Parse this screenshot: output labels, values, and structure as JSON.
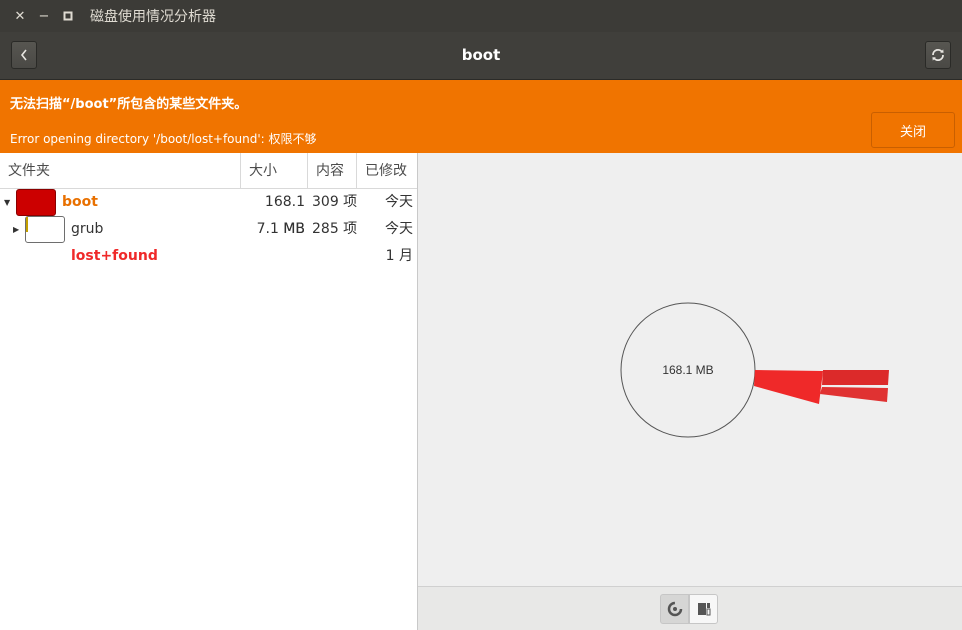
{
  "window": {
    "title": "磁盘使用情况分析器",
    "close_glyph": "✕",
    "minimize_glyph": "−",
    "maximize_glyph": "▫"
  },
  "header": {
    "title": "boot",
    "back_icon": "chevron-left-icon",
    "reload_icon": "refresh-icon"
  },
  "infobar": {
    "title": "无法扫描“/boot”所包含的某些文件夹。",
    "message": "Error opening directory '/boot/lost+found': 权限不够",
    "close_label": "关闭",
    "color": "#f07400"
  },
  "table": {
    "columns": [
      "文件夹",
      "大小",
      "内容",
      "已修改"
    ],
    "rows": [
      {
        "expander": "▼",
        "name": "boot",
        "size": "168.1 MB",
        "contents": "309 项",
        "modified": "今天",
        "name_color": "#e87000",
        "swatch_fill": "#cc0000",
        "swatch_border": "#8a0000",
        "usage_fraction": 1.0
      },
      {
        "expander": "▶",
        "name": "grub",
        "size": "7.1 MB",
        "contents": "285 项",
        "modified": "今天",
        "name_color": "#333333",
        "swatch_fill": "#ffffff",
        "swatch_border": "#6e6e6e",
        "usage_fraction": 0.04
      },
      {
        "expander": "",
        "name": "lost+found",
        "size": "",
        "contents": "",
        "modified": "1 月",
        "name_color": "#ef2929",
        "swatch_fill": "",
        "swatch_border": "",
        "usage_fraction": 0
      }
    ]
  },
  "ring_chart": {
    "center_label": "168.1 MB",
    "segment_color": "#ef2929",
    "segment_color_dark": "#dc2a2a"
  },
  "view_switch": {
    "ring_icon": "ring-chart-icon",
    "treemap_icon": "treemap-icon"
  }
}
